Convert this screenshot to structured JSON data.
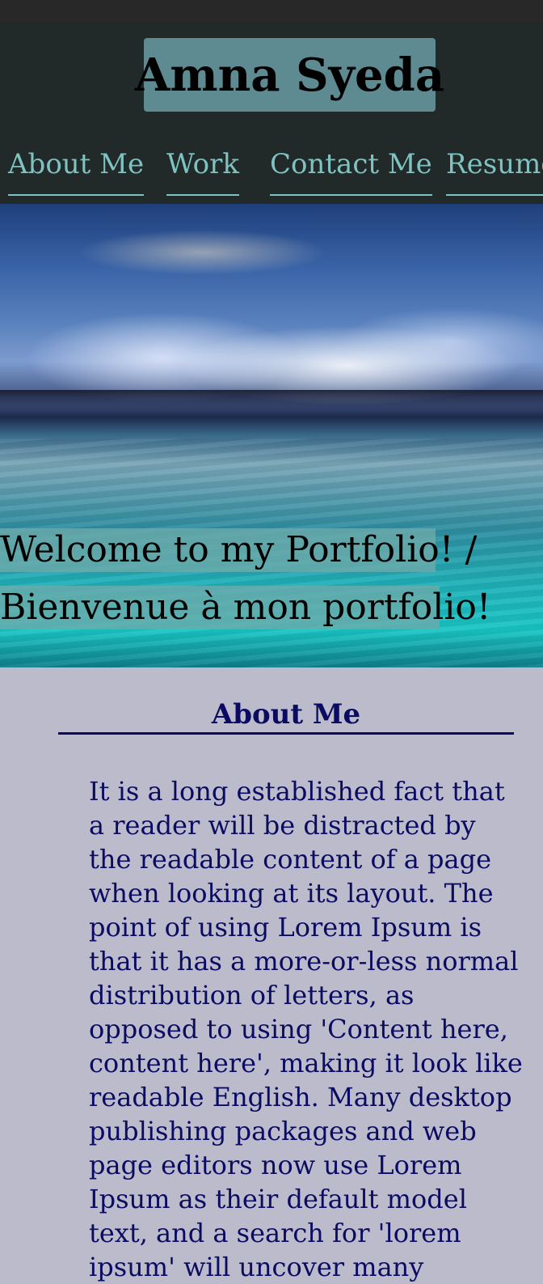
{
  "header": {
    "title": "Amna Syeda"
  },
  "nav": {
    "items": [
      {
        "label": "About Me"
      },
      {
        "label": "Work"
      },
      {
        "label": "Contact Me"
      },
      {
        "label": "Resume"
      }
    ]
  },
  "hero": {
    "welcome_en": " Welcome to my Portfolio! /",
    "welcome_fr": "Bienvenue à mon portfolio!"
  },
  "about": {
    "heading": "About Me",
    "body": "It is a long established fact that a reader will be distracted by the readable content of a page when looking at its layout. The point of using Lorem Ipsum is that it has a more-or-less normal distribution of letters, as opposed to using 'Content here, content here', making it look like readable English. Many desktop publishing packages and web page editors now use Lorem Ipsum as their default model text, and a search for 'lorem ipsum' will uncover many"
  },
  "colors": {
    "header_bg": "#212929",
    "title_bg": "#5e8a92",
    "nav_link": "#7fc2c2",
    "page_bg": "#bbbbcc",
    "about_text": "#0b0b62"
  }
}
